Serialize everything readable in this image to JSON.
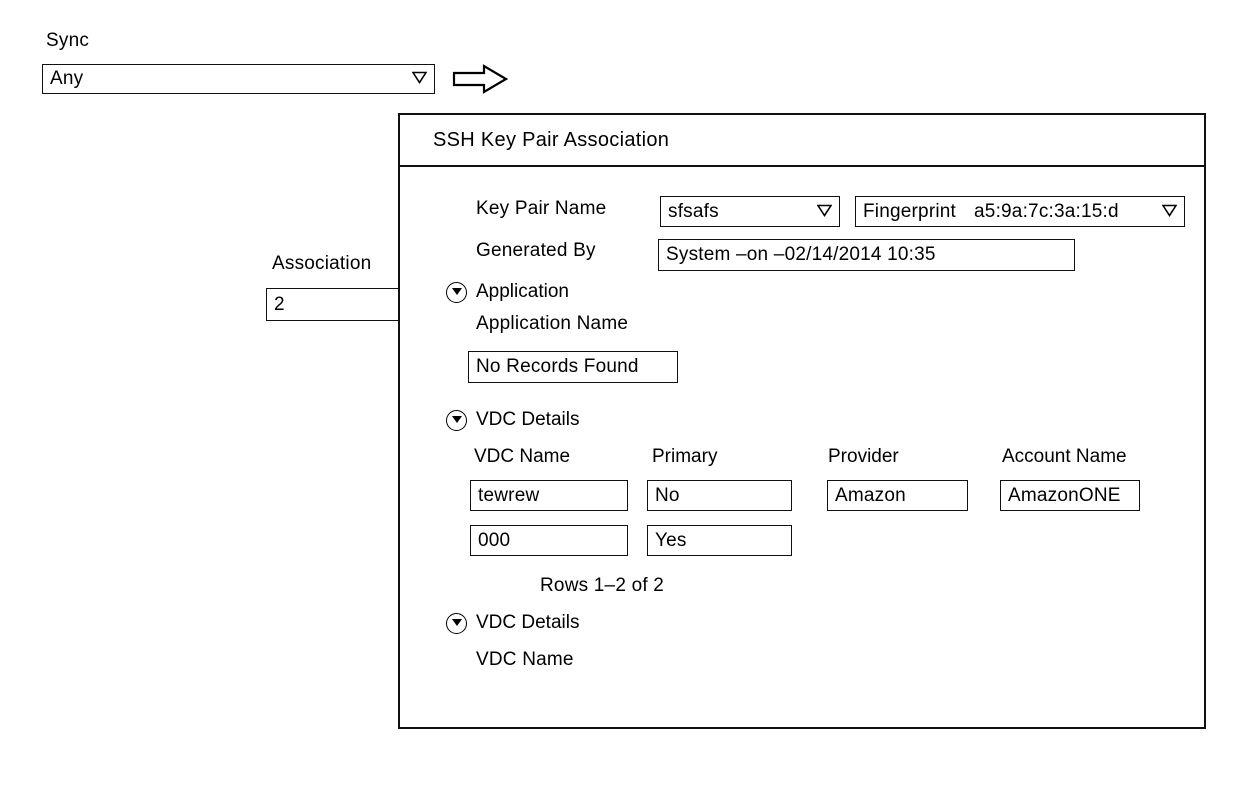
{
  "sync": {
    "label": "Sync",
    "value": "Any",
    "caret_icon": "chevron-down-icon"
  },
  "flow": {
    "arrow_icon": "right-arrow-icon"
  },
  "association": {
    "label": "Association",
    "value": "2"
  },
  "dialog": {
    "title": "SSH Key Pair Association",
    "key_pair": {
      "label": "Key Pair Name",
      "value": "sfsafs",
      "caret_icon": "chevron-down-icon"
    },
    "fingerprint": {
      "label": "Fingerprint",
      "value": "a5:9a:7c:3a:15:d",
      "caret_icon": "chevron-down-icon"
    },
    "generated_by": {
      "label": "Generated By",
      "value": "System –on –02/14/2014 10:35"
    },
    "application_section": {
      "title": "Application",
      "toggle_icon": "circle-chevron-down-icon",
      "column_header": "Application Name",
      "empty_message": "No Records Found"
    },
    "vdc_section": {
      "title": "VDC Details",
      "toggle_icon": "circle-chevron-down-icon",
      "columns": [
        "VDC Name",
        "Primary",
        "Provider",
        "Account Name"
      ],
      "rows": [
        {
          "vdc_name": "tewrew",
          "primary": "No",
          "provider": "Amazon",
          "account_name": "AmazonONE"
        },
        {
          "vdc_name": "000",
          "primary": "Yes",
          "provider": "",
          "account_name": ""
        }
      ],
      "rows_count": "Rows 1–2 of 2"
    },
    "vdc_section_2": {
      "title": "VDC Details",
      "toggle_icon": "circle-chevron-down-icon",
      "column_header": "VDC Name"
    }
  },
  "colors": {
    "line": "#111111",
    "background": "#ffffff",
    "text": "#000000"
  }
}
